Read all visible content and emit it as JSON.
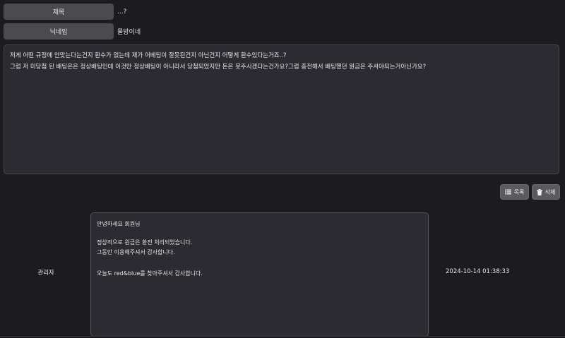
{
  "post": {
    "title_label": "제목",
    "title_value": "...?",
    "nickname_label": "닉네임",
    "nickname_value": "물방이네",
    "content_line1": "저게 어떤 규정에 안맞는다는건지 환수가 없는데 제가 어베팅이 잘못된건지 아닌건지 어떻게 환수있다는거죠..?",
    "content_line2": "그럼 저 미당첨 된 배팅은은 정상배팅인데 이것만 정상배팅이 아니라서 당첨되었지만 돈은 못주시겠다는건가요?그럼 충전해서 배팅했던 원금은 주셔야되는거아닌가요?"
  },
  "buttons": {
    "list_label": "목록",
    "delete_label": "삭제",
    "list_icon": "list-icon",
    "delete_icon": "trash-icon"
  },
  "reply": {
    "author": "관리자",
    "line1": "안녕하세요 회원님",
    "line2": "정상적으로 원금은 환전 처리되었습니다.",
    "line3": "그동안 이용해주셔서 감사합니다.",
    "line4": "오늘도 red&blue를 찾아주셔서 감사합니다.",
    "timestamp": "2024-10-14 01:38:33"
  }
}
